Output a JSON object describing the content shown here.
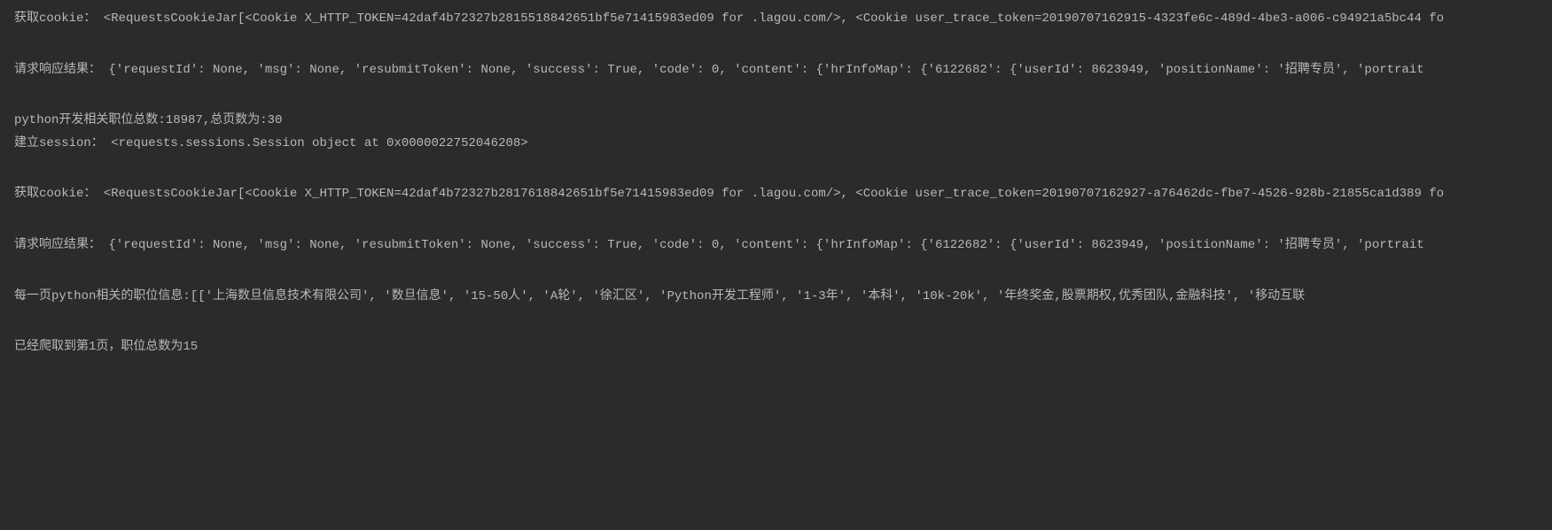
{
  "console": {
    "lines": [
      "获取cookie：  <RequestsCookieJar[<Cookie X_HTTP_TOKEN=42daf4b72327b2815518842651bf5e71415983ed09 for .lagou.com/>, <Cookie user_trace_token=20190707162915-4323fe6c-489d-4be3-a006-c94921a5bc44 fo",
      "",
      "",
      "请求响应结果：  {'requestId': None, 'msg': None, 'resubmitToken': None, 'success': True, 'code': 0, 'content': {'hrInfoMap': {'6122682': {'userId': 8623949, 'positionName': '招聘专员', 'portrait",
      "",
      "",
      "python开发相关职位总数:18987,总页数为:30",
      "建立session：  <requests.sessions.Session object at 0x0000022752046208>",
      "",
      "",
      "获取cookie：  <RequestsCookieJar[<Cookie X_HTTP_TOKEN=42daf4b72327b2817618842651bf5e71415983ed09 for .lagou.com/>, <Cookie user_trace_token=20190707162927-a76462dc-fbe7-4526-928b-21855ca1d389 fo",
      "",
      "",
      "请求响应结果：  {'requestId': None, 'msg': None, 'resubmitToken': None, 'success': True, 'code': 0, 'content': {'hrInfoMap': {'6122682': {'userId': 8623949, 'positionName': '招聘专员', 'portrait",
      "",
      "",
      "每一页python相关的职位信息:[['上海数旦信息技术有限公司', '数旦信息', '15-50人', 'A轮', '徐汇区', 'Python开发工程师', '1-3年', '本科', '10k-20k', '年终奖金,股票期权,优秀团队,金融科技', '移动互联",
      "",
      "",
      "已经爬取到第1页，职位总数为15"
    ]
  }
}
